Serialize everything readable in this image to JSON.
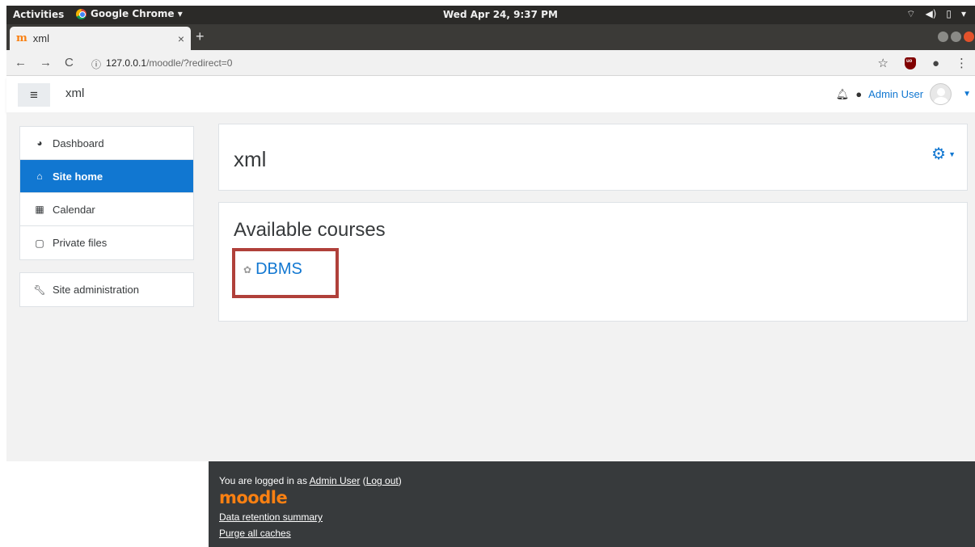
{
  "os_bar": {
    "activities": "Activities",
    "app_name": "Google Chrome ▾",
    "clock": "Wed Apr 24,  9:37 PM"
  },
  "browser": {
    "tab_title": "xml",
    "new_tab": "+",
    "url_host": "127.0.0.1",
    "url_path": "/moodle/?redirect=0"
  },
  "header": {
    "site_name": "xml",
    "user_name": "Admin User"
  },
  "nav": {
    "items": [
      {
        "label": "Dashboard",
        "icon": "dashboard-icon"
      },
      {
        "label": "Site home",
        "icon": "home-icon",
        "active": true
      },
      {
        "label": "Calendar",
        "icon": "calendar-icon"
      },
      {
        "label": "Private files",
        "icon": "file-icon"
      }
    ],
    "admin": {
      "label": "Site administration",
      "icon": "wrench-icon"
    }
  },
  "main": {
    "page_title": "xml",
    "section_title": "Available courses",
    "courses": [
      {
        "name": "DBMS"
      }
    ]
  },
  "footer": {
    "logged_in_prefix": "You are logged in as ",
    "user_link": "Admin User",
    "logout_link": "Log out",
    "logo_text": "moodle",
    "data_retention": "Data retention summary",
    "purge_caches": "Purge all caches"
  },
  "colors": {
    "accent": "#1177d1",
    "highlight_box": "#b0403a",
    "footer_bg": "#373a3c",
    "moodle_orange": "#f98012"
  }
}
